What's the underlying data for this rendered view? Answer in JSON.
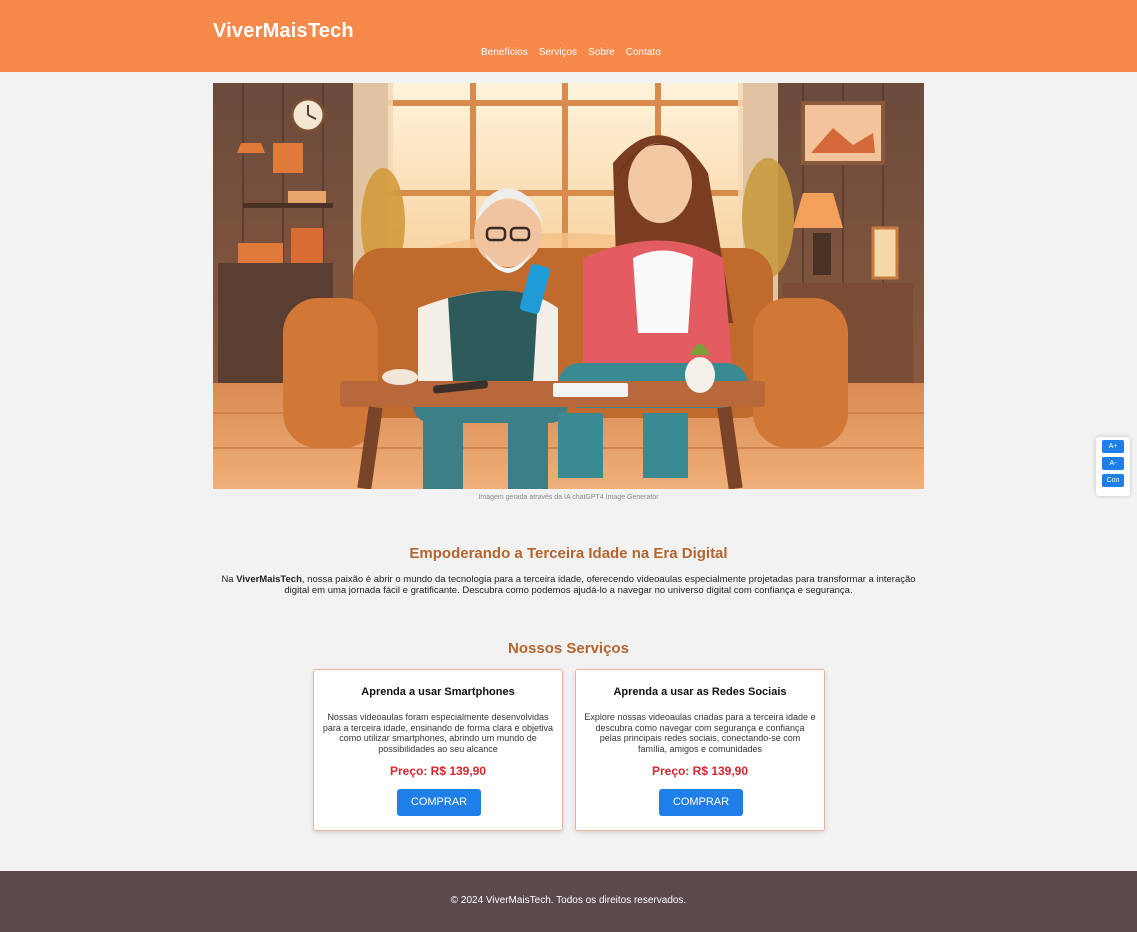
{
  "header": {
    "brand": "ViverMaisTech",
    "nav": [
      "Benefícios",
      "Serviços",
      "Sobre",
      "Contato"
    ]
  },
  "hero": {
    "caption": "Imagem gerada através da IA chatGPT4 Image Generator"
  },
  "intro": {
    "title": "Empoderando a Terceira Idade na Era Digital",
    "prefix": "Na ",
    "brand": "ViverMaisTech",
    "text": ", nossa paixão é abrir o mundo da tecnologia para a terceira idade, oferecendo videoaulas especialmente projetadas para transformar a interação digital em uma jornada fácil e gratificante. Descubra como podemos ajudá-lo a navegar no universo digital com confiança e segurança."
  },
  "services": {
    "title": "Nossos Serviços",
    "cards": [
      {
        "title": "Aprenda a usar Smartphones",
        "description": "Nossas videoaulas foram especialmente desenvolvidas para a terceira idade, ensinando de forma clara e objetiva como utilizar smartphones, abrindo um mundo de possibilidades ao seu alcance",
        "price": "Preço: R$ 139,90",
        "button": "COMPRAR"
      },
      {
        "title": "Aprenda a usar as Redes Sociais",
        "description": "Explore nossas videoaulas criadas para a terceira idade e descubra como navegar com segurança e confiança pelas principais redes sociais, conectando-se com família, amigos e comunidades",
        "price": "Preço: R$ 139,90",
        "button": "COMPRAR"
      }
    ]
  },
  "footer": {
    "text": "© 2024 ViverMaisTech. Todos os direitos reservados."
  },
  "accessibility": {
    "increase": "A+",
    "decrease": "A-",
    "contrast": "Con"
  },
  "colors": {
    "header": "#f7894a",
    "accent": "#b5652e",
    "price": "#d7262e",
    "button": "#1e7fe8",
    "footer": "#5a4a4c"
  }
}
